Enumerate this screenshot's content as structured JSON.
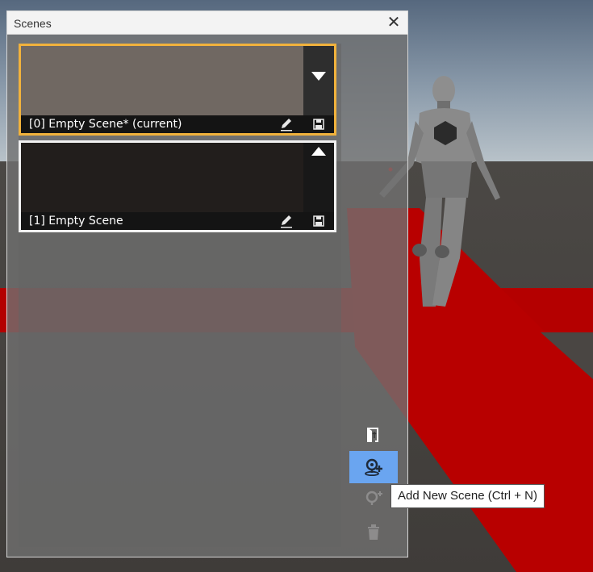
{
  "window": {
    "title": "Scenes",
    "close_icon": "✕"
  },
  "scenes": [
    {
      "label": "[0] Empty Scene* (current)",
      "current": true,
      "arrow": "down",
      "thumb_color": "#706862"
    },
    {
      "label": "[1] Empty Scene",
      "current": false,
      "arrow": "up",
      "thumb_color": "#221e1c"
    }
  ],
  "tools": {
    "export_icon": "scene-export-icon",
    "add_icon": "add-scene-icon",
    "duplicate_icon": "duplicate-scene-icon",
    "delete_icon": "trash-icon"
  },
  "tooltip": {
    "text": "Add New Scene (Ctrl + N)"
  },
  "colors": {
    "current_border": "#f1b23c",
    "selected_tool": "#6aa5f0",
    "floor_red": "#b80000"
  }
}
